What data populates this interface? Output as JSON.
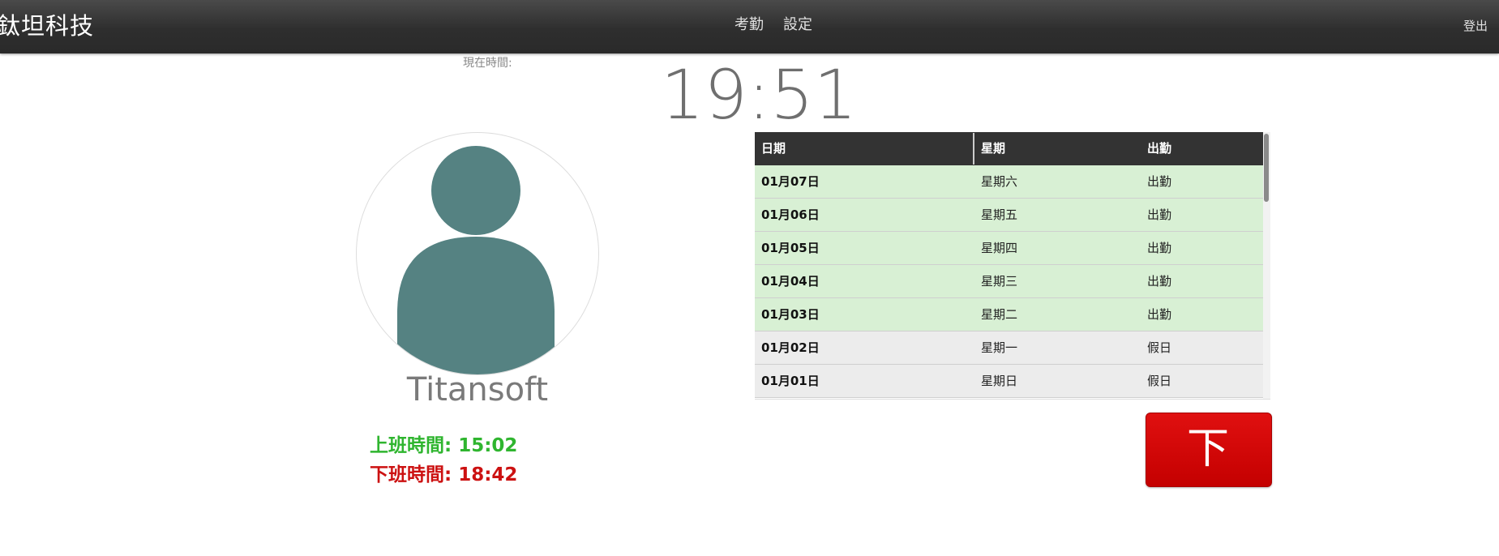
{
  "navbar": {
    "brand": "鈦坦科技",
    "links": [
      "考勤",
      "設定"
    ],
    "logout": "登出"
  },
  "clock": {
    "label": "現在時間:",
    "time": "19:51"
  },
  "profile": {
    "name": "Titansoft",
    "avatar_icon": "user-silhouette-icon",
    "avatar_color": "#558282",
    "clock_in_label": "上班時間: 15:02",
    "clock_out_label": "下班時間: 18:42",
    "clock_in_color": "#2fb52f",
    "clock_out_color": "#cc1111"
  },
  "attendance_table": {
    "columns": [
      "日期",
      "星期",
      "出勤"
    ],
    "rows": [
      {
        "date": "01月07日",
        "weekday": "星期六",
        "status": "出勤",
        "type": "work"
      },
      {
        "date": "01月06日",
        "weekday": "星期五",
        "status": "出勤",
        "type": "work"
      },
      {
        "date": "01月05日",
        "weekday": "星期四",
        "status": "出勤",
        "type": "work"
      },
      {
        "date": "01月04日",
        "weekday": "星期三",
        "status": "出勤",
        "type": "work"
      },
      {
        "date": "01月03日",
        "weekday": "星期二",
        "status": "出勤",
        "type": "work"
      },
      {
        "date": "01月02日",
        "weekday": "星期一",
        "status": "假日",
        "type": "holiday"
      },
      {
        "date": "01月01日",
        "weekday": "星期日",
        "status": "假日",
        "type": "holiday"
      }
    ],
    "work_color": "#d8f0d4",
    "holiday_color": "#ececec"
  },
  "actions": {
    "clock_out_button": "下班",
    "button_color": "#cc0000"
  }
}
